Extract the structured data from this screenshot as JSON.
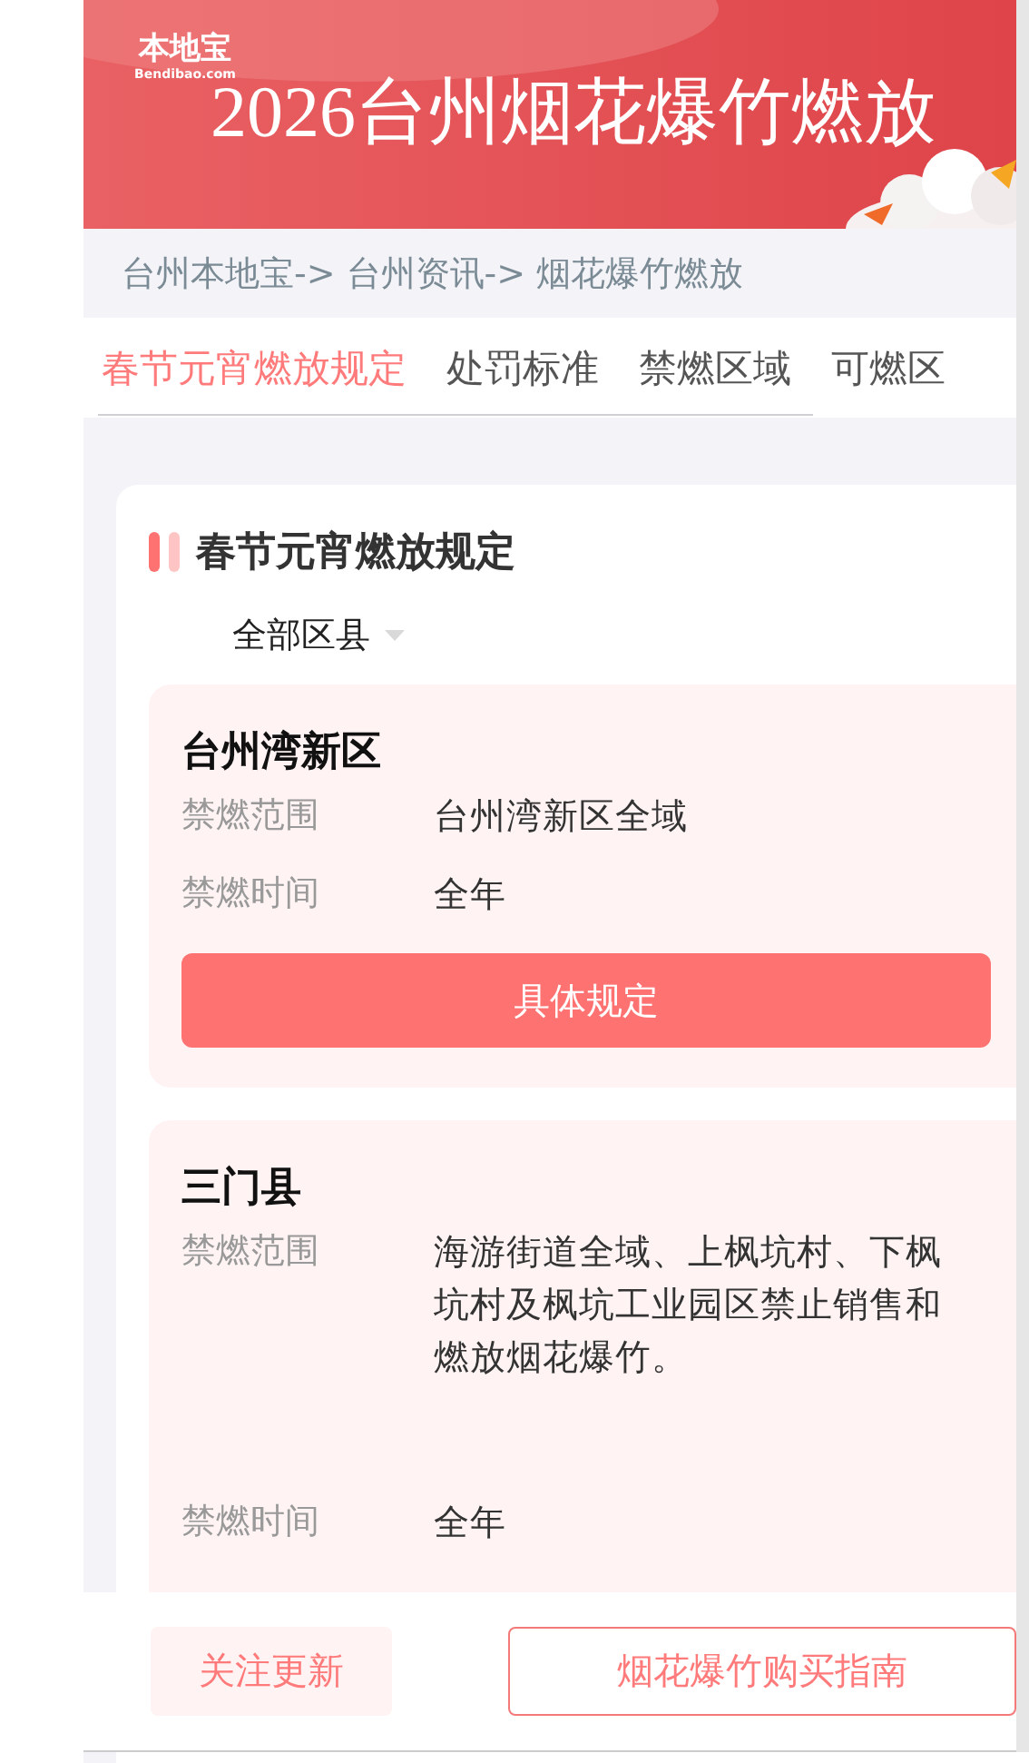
{
  "banner": {
    "logo": "本地宝",
    "logo_sub": "Bendibao.com",
    "year": "2026",
    "title": "台州烟花爆竹燃放"
  },
  "breadcrumb": [
    "台州本地宝->",
    "台州资讯->",
    "烟花爆竹燃放"
  ],
  "tabs": [
    {
      "label": "春节元宵燃放规定",
      "selected": true
    },
    {
      "label": "处罚标准",
      "selected": false
    },
    {
      "label": "禁燃区域",
      "selected": false
    },
    {
      "label": "可燃区",
      "selected": false
    }
  ],
  "section": {
    "title": "春节元宵燃放规定",
    "filter": "全部区县",
    "cards": [
      {
        "name": "台州湾新区",
        "rows": [
          {
            "label": "禁燃范围",
            "value": "台州湾新区全域"
          },
          {
            "label": "禁燃时间",
            "value": "全年"
          }
        ],
        "button": "具体规定"
      },
      {
        "name": "三门县",
        "rows": [
          {
            "label": "禁燃范围",
            "value": "海游街道全域、上枫坑村、下枫坑村及枫坑工业园区禁止销售和燃放烟花爆竹。"
          },
          {
            "label": "禁燃时间",
            "value": "全年"
          }
        ]
      }
    ]
  },
  "bottom_bar": {
    "follow": "关注更新",
    "guide": "烟花爆竹购买指南"
  }
}
